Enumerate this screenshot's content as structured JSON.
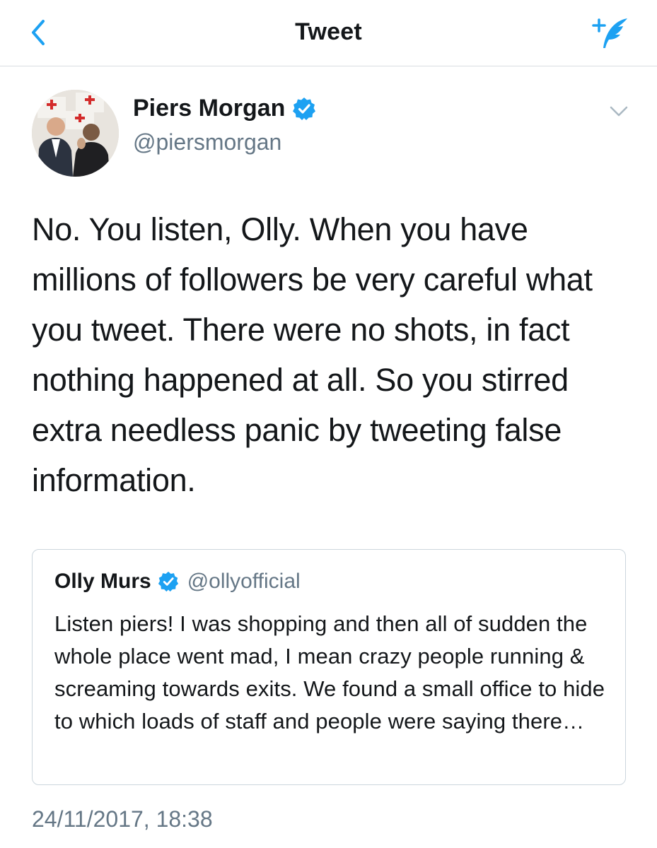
{
  "nav": {
    "title": "Tweet",
    "back_icon": "chevron-left-icon",
    "compose_icon": "compose-feather-icon",
    "accent_color": "#1da1f2"
  },
  "author": {
    "name": "Piers Morgan",
    "handle": "@piersmorgan",
    "verified": true,
    "avatar_icon": "avatar-photo"
  },
  "tweet": {
    "text": "No. You listen, Olly. When you have millions of followers be very careful what you tweet. There were no shots, in fact nothing happened at all. So you stirred extra needless panic by tweeting false information."
  },
  "quoted_tweet": {
    "name": "Olly Murs",
    "handle": "@ollyofficial",
    "verified": true,
    "text": "Listen piers! I was shopping and then all of sudden the whole place went mad, I mean crazy people running & screaming towards exits. We found a small office to hide to which loads of staff and people were saying there…"
  },
  "timestamp": "24/11/2017, 18:38",
  "colors": {
    "text_primary": "#14171a",
    "text_secondary": "#657786",
    "accent": "#1da1f2",
    "border": "#ccd6dd"
  }
}
